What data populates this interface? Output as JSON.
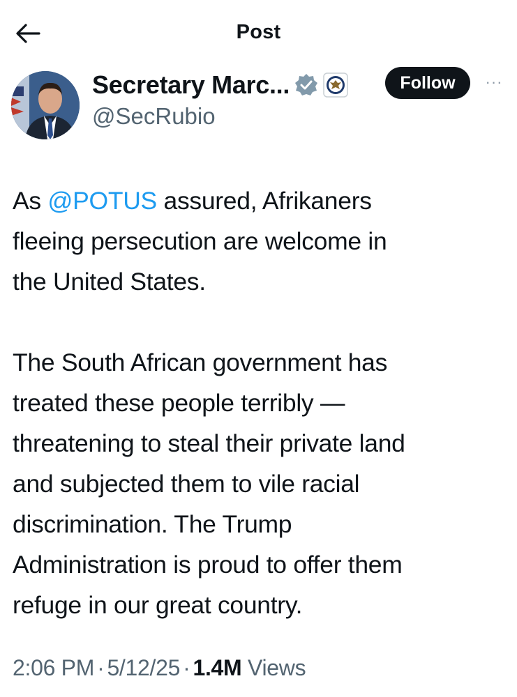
{
  "header": {
    "title": "Post",
    "back_icon": "arrow-left-icon"
  },
  "author": {
    "display_name": "Secretary Marc...",
    "handle": "@SecRubio",
    "verified_icon": "verified-badge-icon",
    "affiliation_icon": "state-department-seal-icon",
    "follow_label": "Follow",
    "more_icon": "more-icon",
    "more_label": "···"
  },
  "tweet": {
    "p1_prefix": "As ",
    "p1_mention": "@POTUS",
    "p1_rest": " assured, Afrikaners\nfleeing persecution are welcome in\nthe United States.",
    "p2": "The South African government has\ntreated these people terribly —\nthreatening to steal their private land\nand subjected them to vile racial\ndiscrimination. The Trump\nAdministration is proud to offer them\nrefuge in our great country."
  },
  "meta": {
    "time": "2:06 PM",
    "separator": "·",
    "date": "5/12/25",
    "views_count": "1.4M",
    "views_label": "Views"
  },
  "colors": {
    "text": "#0f1419",
    "secondary": "#536471",
    "accent": "#1d9bf0",
    "follow_bg": "#0f1419"
  }
}
